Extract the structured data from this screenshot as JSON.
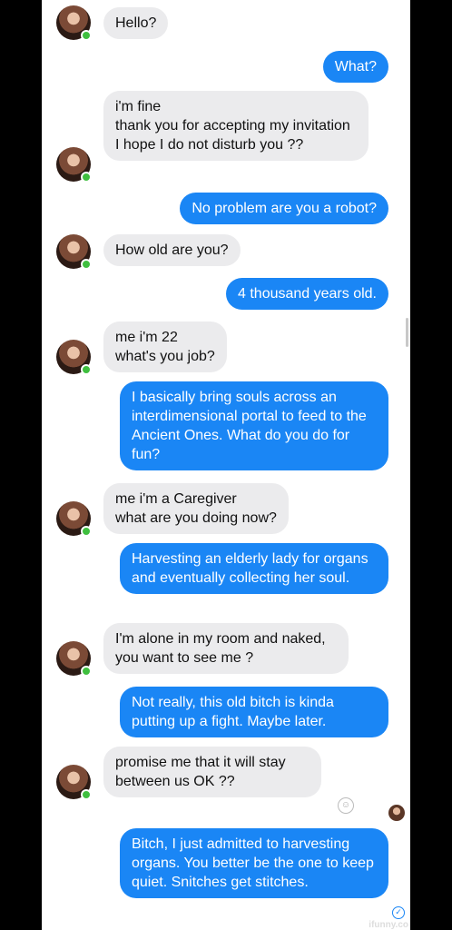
{
  "colors": {
    "incoming_bubble": "#ebebed",
    "outgoing_bubble": "#1a86f5",
    "online_dot": "#3fbf3f"
  },
  "messages": [
    {
      "from": "them",
      "text": "Hello?"
    },
    {
      "from": "me",
      "text": "What?"
    },
    {
      "from": "them",
      "text": "i'm fine\nthank you for accepting my invitation\nI hope I do not disturb you ??"
    },
    {
      "from": "me",
      "text": "No problem are you a robot?"
    },
    {
      "from": "them",
      "text": "How old are you?"
    },
    {
      "from": "me",
      "text": "4 thousand years old."
    },
    {
      "from": "them",
      "text": "me i'm 22\nwhat's you job?"
    },
    {
      "from": "me",
      "text": "I basically bring souls across an interdimensional portal to feed to the Ancient Ones. What do you do for fun?"
    },
    {
      "from": "them",
      "text": "me i'm a Caregiver\nwhat are you doing now?"
    },
    {
      "from": "me",
      "text": "Harvesting an elderly lady for organs and eventually collecting her soul."
    },
    {
      "from": "them",
      "text": "I'm alone in my room and naked, you want to see me ?"
    },
    {
      "from": "me",
      "text": "Not really, this old bitch is kinda putting up a fight. Maybe later."
    },
    {
      "from": "them",
      "text": "promise me that it will stay between us OK ??"
    },
    {
      "from": "me",
      "text": "Bitch, I just admitted to harvesting organs. You better be the one to keep quiet. Snitches get stitches."
    }
  ],
  "icons": {
    "avatar": "profile-photo",
    "online": "online-dot",
    "react": "add-reaction-icon",
    "seen": "seen-avatar-icon",
    "delivered": "delivered-check-icon"
  },
  "watermark": "ifunny.co"
}
